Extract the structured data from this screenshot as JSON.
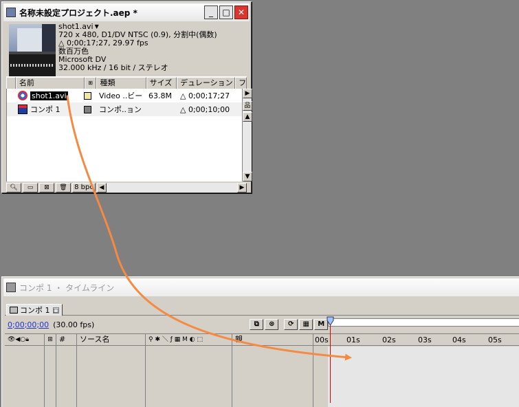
{
  "project": {
    "title": "名称未設定プロジェクト.aep *",
    "buttons": {
      "minimize": "_",
      "maximize": "□",
      "close": "✕"
    },
    "info": {
      "name": "shot1.avi",
      "line1": "720 x 480, D1/DV NTSC (0.9), 分割中(偶数)",
      "line2": "△ 0;00;17;27, 29.97 fps",
      "line3": "数百万色",
      "line4": "Microsoft DV",
      "line5": "32.000 kHz / 16 bit / ステレオ"
    },
    "columns": {
      "name": "名前",
      "type": "種類",
      "size": "サイズ",
      "duration": "デュレーション",
      "extra": "ファ"
    },
    "items": [
      {
        "name": "shot1.avi",
        "type": "Video ..ビー",
        "size": "63.8M",
        "duration": "△ 0;00;17;27",
        "swatch": "#f0e8a0"
      },
      {
        "name": "コンポ 1",
        "type": "コンポ..ョン",
        "size": "",
        "duration": "△ 0;00;10;00",
        "swatch": "#808080"
      }
    ],
    "footer": {
      "bpc": "8 bpc"
    }
  },
  "timeline": {
    "title": "コンポ 1 ・ タイムライン",
    "tab": "コンポ 1",
    "timecode": "0;00;00;00",
    "fps": "(30.00 fps)",
    "columns": {
      "number": "#",
      "source": "ソース名",
      "parent": "親"
    },
    "ruler": [
      "00s",
      "01s",
      "02s",
      "03s",
      "04s",
      "05s"
    ],
    "colors": {
      "playhead": "#dd0000",
      "annotation": "#f58a42"
    }
  }
}
